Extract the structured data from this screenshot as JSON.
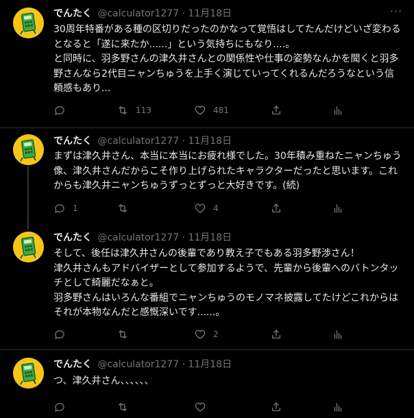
{
  "tweets": [
    {
      "name": "でんたく",
      "handle": "@calculator1277",
      "dot": "·",
      "date": "11月18日",
      "text": "30周年特番がある種の区切りだったのかなって覚悟はしてたんだけどいざ変わるとなると「遂に来たか......」という気持ちにもなり....。\nと同時に、羽多野さんの津久井さんとの関係性や仕事の姿勢なんかを聞くと羽多野さんなら2代目ニャンちゅうを上手く演じていってくれるんだろうなという信頼感もあり...",
      "replies": "",
      "retweets": "113",
      "likes": "481"
    },
    {
      "name": "でんたく",
      "handle": "@calculator1277",
      "dot": "·",
      "date": "11月18日",
      "text": "まずは津久井さん、本当に本当にお疲れ様でした。30年積み重ねたニャンちゅう像、津久井さんだからこそ作り上げられたキャラクターだったと思います。これからも津久井ニャンちゅうずっとずっと大好きです。(続)",
      "replies": "1",
      "retweets": "",
      "likes": "4"
    },
    {
      "name": "でんたく",
      "handle": "@calculator1277",
      "dot": "·",
      "date": "11月18日",
      "text": "そして、後任は津久井さんの後輩であり教え子でもある羽多野渉さん！\n津久井さんもアドバイザーとして参加するようで、先輩から後輩へのバトンタッチとして綺麗だなぁと。\n羽多野さんはいろんな番組でニャンちゅうのモノマネ披露してたけどこれからはそれが本物なんだと感慨深いです......。",
      "replies": "",
      "retweets": "",
      "likes": "2"
    },
    {
      "name": "でんたく",
      "handle": "@calculator1277",
      "dot": "·",
      "date": "11月18日",
      "text": "つ、津久井さん、、、、、、",
      "replies": "",
      "retweets": "",
      "likes": ""
    }
  ],
  "icons": {
    "reply": "reply-icon",
    "retweet": "retweet-icon",
    "like": "heart-icon",
    "share": "share-icon",
    "analytics": "analytics-icon",
    "more": "more-icon",
    "avatar": "calculator-avatar"
  },
  "colors": {
    "background": "#000000",
    "text": "#e7e9ea",
    "secondary": "#71767b",
    "divider": "#2f3336",
    "avatar_bg": "#f5c518",
    "avatar_calc": "#4caf50"
  }
}
